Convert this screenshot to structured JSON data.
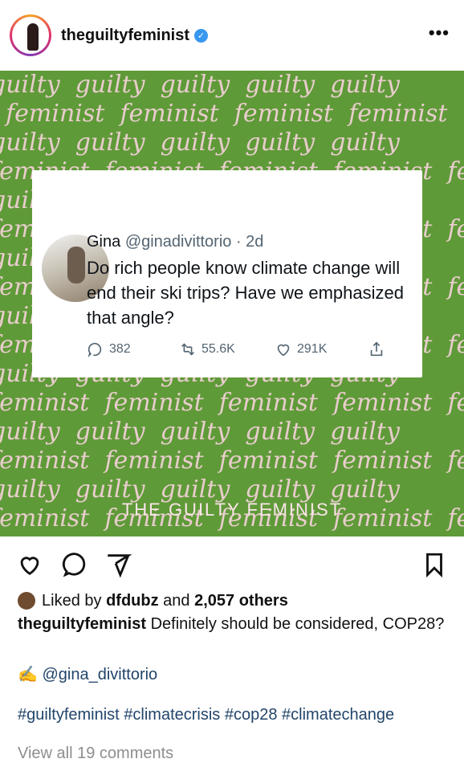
{
  "post": {
    "username": "theguiltyfeminist",
    "verified_mark": "✓",
    "more_menu": "•••"
  },
  "image": {
    "brand_text": "THE GUILTY FEMINIST",
    "pattern_words": [
      "guilty",
      "feminist"
    ],
    "colors": {
      "background": "#5f9a38",
      "script": "#f7d3dd"
    }
  },
  "tweet": {
    "author": "Gina",
    "handle": "@ginadivittorio · 2d",
    "text": "Do rich people know climate change will end their ski trips? Have we emphasized that angle?",
    "replies": "382",
    "retweets": "55.6K",
    "likes": "291K"
  },
  "actions": {
    "icons": [
      "heart-icon",
      "comment-icon",
      "share-icon",
      "bookmark-icon"
    ]
  },
  "likes": {
    "prefix": "Liked by",
    "user": "dfdubz",
    "middle": "and",
    "others": "2,057 others"
  },
  "caption": {
    "user": "theguiltyfeminist",
    "text": "Definitely should be considered, COP28?",
    "mention_emoji": "✍️",
    "mention": "@gina_divittorio",
    "tags": "#guiltyfeminist #climatecrisis #cop28 #climatechange",
    "view_all": "View all 19 comments"
  }
}
